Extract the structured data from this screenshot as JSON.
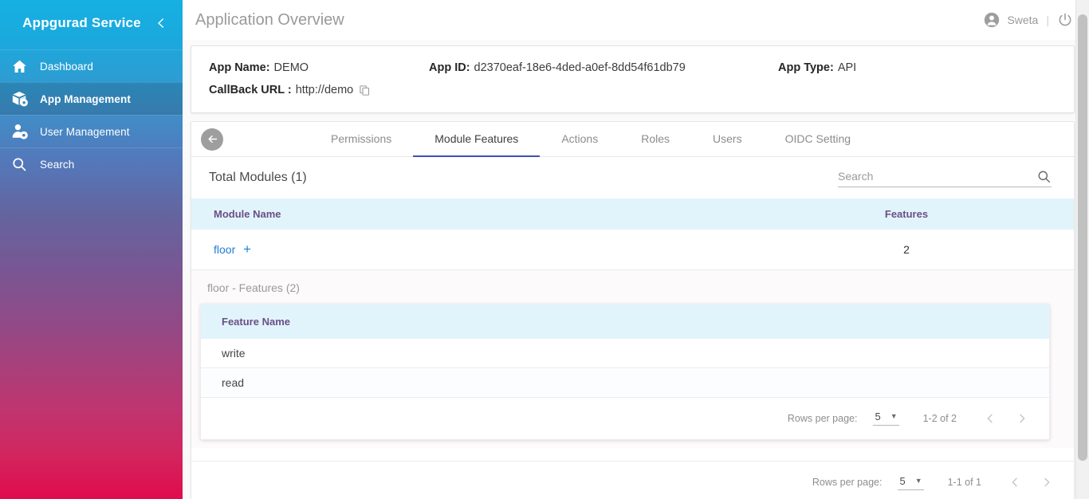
{
  "sidebar": {
    "brand": "Appgurad Service",
    "collapse_icon": "chevron-left-icon",
    "items": [
      {
        "label": "Dashboard",
        "icon": "home-icon",
        "active": false
      },
      {
        "label": "App Management",
        "icon": "box-gear-icon",
        "active": true
      },
      {
        "label": "User Management",
        "icon": "user-gear-icon",
        "active": false
      },
      {
        "label": "Search",
        "icon": "search-icon",
        "active": false
      }
    ]
  },
  "topbar": {
    "title": "Application Overview",
    "user_name": "Sweta",
    "separator": "|",
    "avatar_icon": "account-circle-icon",
    "power_icon": "power-icon"
  },
  "app_info": {
    "app_name_label": "App Name:",
    "app_name_value": "DEMO",
    "app_id_label": "App ID:",
    "app_id_value": "d2370eaf-18e6-4ded-a0ef-8dd54f61db79",
    "app_type_label": "App Type:",
    "app_type_value": "API",
    "callback_label": "CallBack URL :",
    "callback_value": "http://demo",
    "copy_icon": "copy-icon"
  },
  "tabs": {
    "back_icon": "arrow-left-icon",
    "items": [
      {
        "label": "Permissions",
        "active": false
      },
      {
        "label": "Module Features",
        "active": true
      },
      {
        "label": "Actions",
        "active": false
      },
      {
        "label": "Roles",
        "active": false
      },
      {
        "label": "Users",
        "active": false
      },
      {
        "label": "OIDC Setting",
        "active": false
      }
    ]
  },
  "modules_section": {
    "heading": "Total Modules (1)",
    "search": {
      "value": "",
      "placeholder": "Search",
      "icon": "search-icon"
    },
    "columns": [
      "Module Name",
      "Features"
    ],
    "rows": [
      {
        "name": "floor",
        "add_icon": "plus-icon",
        "features": "2"
      }
    ],
    "pagination": {
      "rows_per_page_label": "Rows per page:",
      "rows_per_page_value": "5",
      "caret_icon": "chevron-down-icon",
      "range": "1-1 of 1",
      "prev_icon": "chevron-left-icon",
      "next_icon": "chevron-right-icon"
    }
  },
  "features_section": {
    "title": "floor - Features (2)",
    "columns": [
      "Feature Name"
    ],
    "rows": [
      {
        "name": "write"
      },
      {
        "name": "read"
      }
    ],
    "pagination": {
      "rows_per_page_label": "Rows per page:",
      "rows_per_page_value": "5",
      "caret_icon": "chevron-down-icon",
      "range": "1-2 of 2",
      "prev_icon": "chevron-left-icon",
      "next_icon": "chevron-right-icon"
    }
  },
  "colors": {
    "accent_tab": "#3f51b5",
    "link": "#1f7fd4",
    "table_header_bg": "#e2f4fb",
    "table_header_text": "#6a4f86",
    "sidebar_top": "#16b0e3",
    "sidebar_bottom": "#e00b4c"
  }
}
